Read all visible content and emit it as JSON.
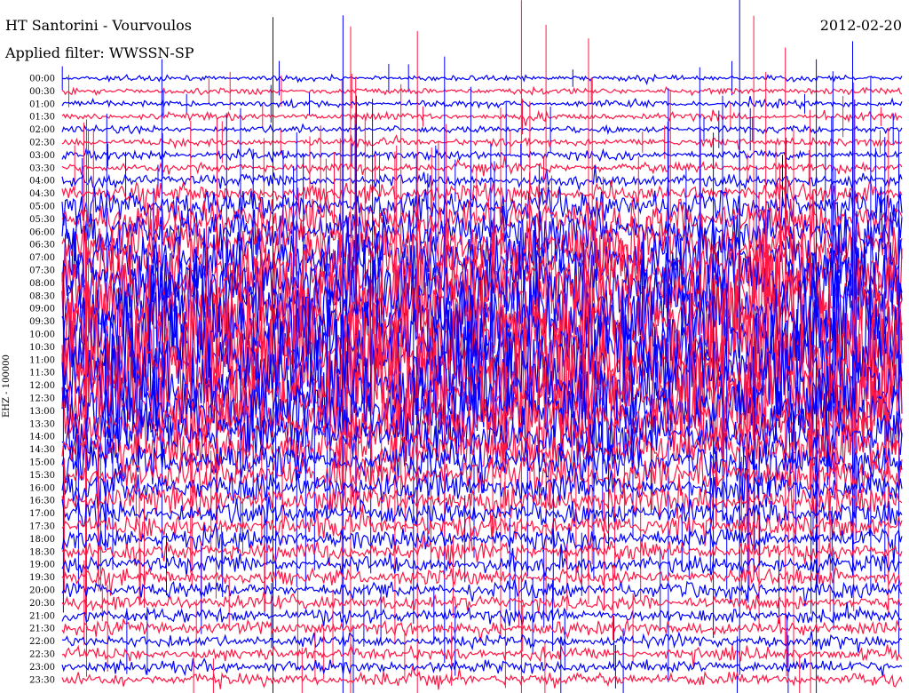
{
  "header": {
    "title": "HT Santorini - Vourvoulos",
    "filter": "Applied filter: WWSSN-SP",
    "date": "2012-02-20",
    "channel": "EHZ - 100000"
  },
  "chart_data": {
    "type": "line",
    "title": "HT Santorini - Vourvoulos",
    "subtitle": "Applied filter: WWSSN-SP",
    "date": "2012-02-20",
    "ylabel": "EHZ - 100000",
    "row_labels": [
      "00:00",
      "00:30",
      "01:00",
      "01:30",
      "02:00",
      "02:30",
      "03:00",
      "03:30",
      "04:00",
      "04:30",
      "05:00",
      "05:30",
      "06:00",
      "06:30",
      "07:00",
      "07:30",
      "08:00",
      "08:30",
      "09:00",
      "09:30",
      "10:00",
      "10:30",
      "11:00",
      "11:30",
      "12:00",
      "12:30",
      "13:00",
      "13:30",
      "14:00",
      "14:30",
      "15:00",
      "15:30",
      "16:00",
      "16:30",
      "17:00",
      "17:30",
      "18:00",
      "18:30",
      "19:00",
      "19:30",
      "20:00",
      "20:30",
      "21:00",
      "21:30",
      "22:00",
      "22:30",
      "23:00",
      "23:30"
    ],
    "colors": [
      "#0000ff",
      "#ff1744"
    ],
    "noise_amplitude": [
      0.35,
      0.4,
      0.45,
      0.45,
      0.45,
      0.5,
      0.55,
      0.6,
      0.8,
      1.2,
      2.0,
      2.5,
      3.0,
      3.5,
      4.0,
      4.5,
      5.0,
      5.5,
      6.0,
      6.5,
      7.0,
      7.0,
      7.0,
      7.0,
      6.5,
      6.0,
      5.0,
      4.0,
      3.5,
      3.0,
      2.5,
      2.2,
      2.0,
      1.8,
      1.6,
      1.4,
      1.3,
      1.2,
      1.1,
      1.0,
      1.0,
      0.9,
      0.9,
      0.9,
      0.8,
      0.8,
      0.8,
      0.8
    ]
  }
}
